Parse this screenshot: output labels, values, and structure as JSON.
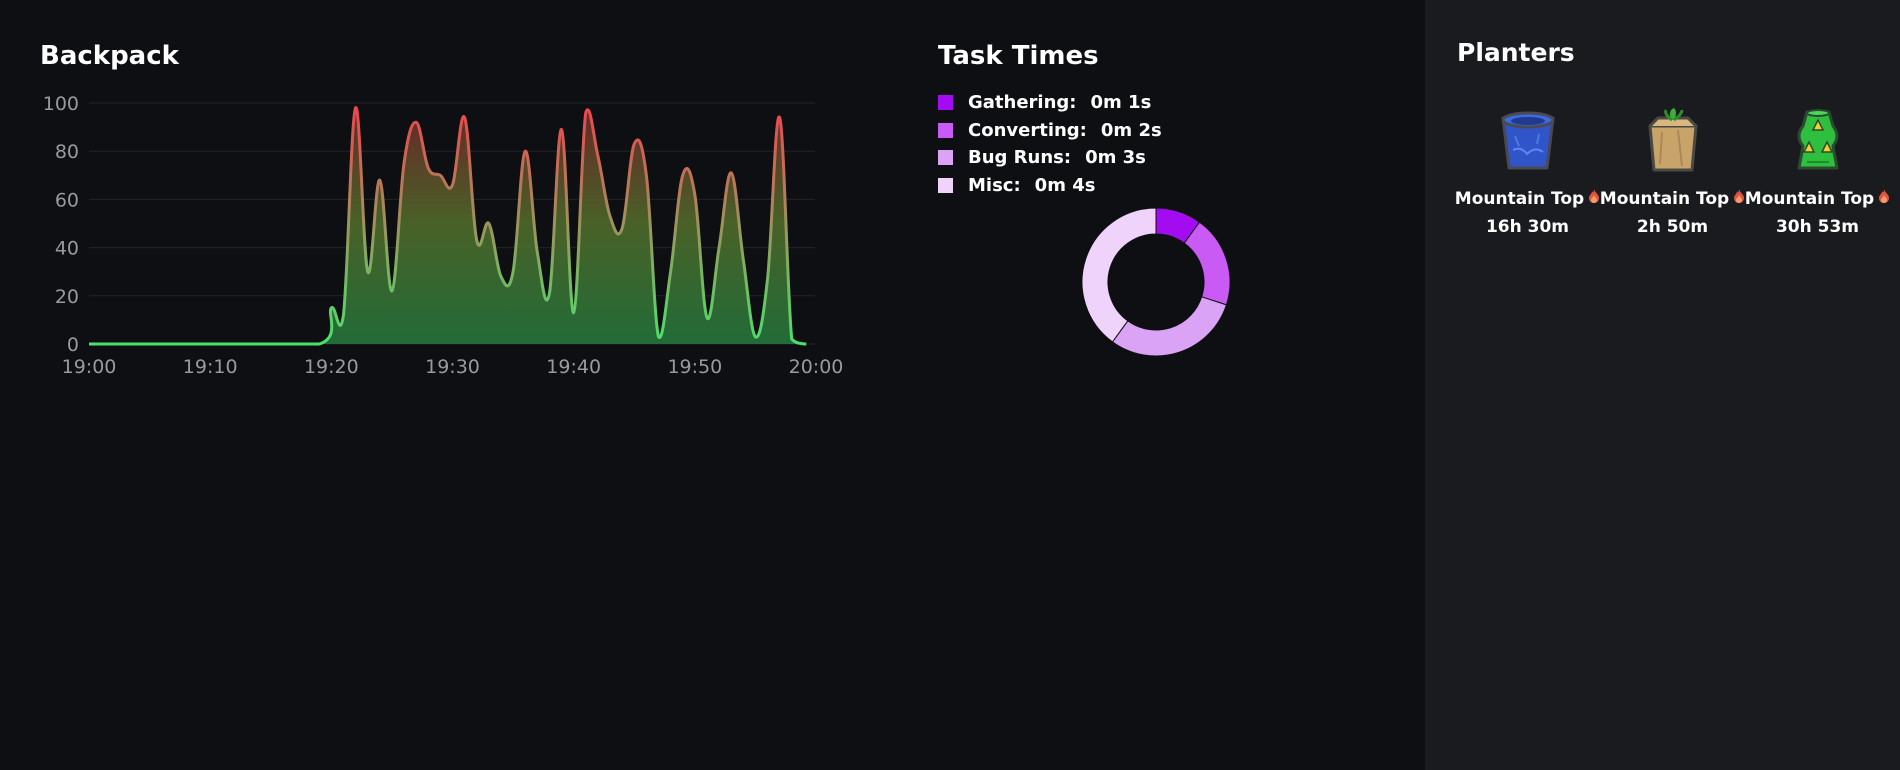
{
  "backpack": {
    "title": "Backpack"
  },
  "chart_data": [
    {
      "type": "area",
      "title": "Backpack",
      "xlabel": "",
      "ylabel": "",
      "ylim": [
        0,
        100
      ],
      "xlim": [
        "19:00",
        "20:00"
      ],
      "y_ticks": [
        "0",
        "20",
        "40",
        "60",
        "80",
        "100"
      ],
      "x_ticks": [
        "19:00",
        "19:10",
        "19:20",
        "19:30",
        "19:40",
        "19:50",
        "20:00"
      ],
      "grid": true,
      "x_minutes": [
        0,
        10,
        19,
        20,
        21,
        22,
        23,
        24,
        25,
        26,
        27,
        28,
        29,
        30,
        31,
        32,
        33,
        34,
        35,
        36,
        37,
        38,
        39,
        40,
        41,
        42,
        43,
        44,
        45,
        46,
        47,
        48,
        49,
        50,
        51,
        52,
        53,
        54,
        55,
        56,
        57,
        58,
        59,
        59.2
      ],
      "values": [
        0,
        0,
        0,
        15,
        12,
        98,
        30,
        68,
        22,
        75,
        92,
        73,
        70,
        66,
        94,
        43,
        50,
        28,
        30,
        80,
        38,
        21,
        89,
        13,
        96,
        78,
        53,
        48,
        83,
        70,
        3,
        30,
        70,
        62,
        11,
        40,
        71,
        35,
        3,
        27,
        94,
        2,
        0,
        0
      ],
      "colors": {
        "low": "#4be06a",
        "high": "#f0434f"
      }
    },
    {
      "type": "pie",
      "title": "Task Times",
      "categories": [
        "Gathering:",
        "Converting:",
        "Bug Runs:",
        "Misc:"
      ],
      "values": [
        1,
        2,
        3,
        4
      ],
      "value_labels": [
        "0m 1s",
        "0m 2s",
        "0m 3s",
        "0m 4s"
      ],
      "colors": [
        "#a30cf0",
        "#c95af4",
        "#daa3f6",
        "#efd3fa"
      ]
    }
  ],
  "tasks": {
    "title": "Task Times"
  },
  "planters": {
    "title": "Planters",
    "items": [
      {
        "field": "Mountain Top",
        "time": "16h 30m",
        "icon": "blue-clay-planter-icon"
      },
      {
        "field": "Mountain Top",
        "time": "2h 50m",
        "icon": "paper-planter-icon"
      },
      {
        "field": "Mountain Top",
        "time": "30h 53m",
        "icon": "hydroponic-planter-icon"
      }
    ]
  }
}
